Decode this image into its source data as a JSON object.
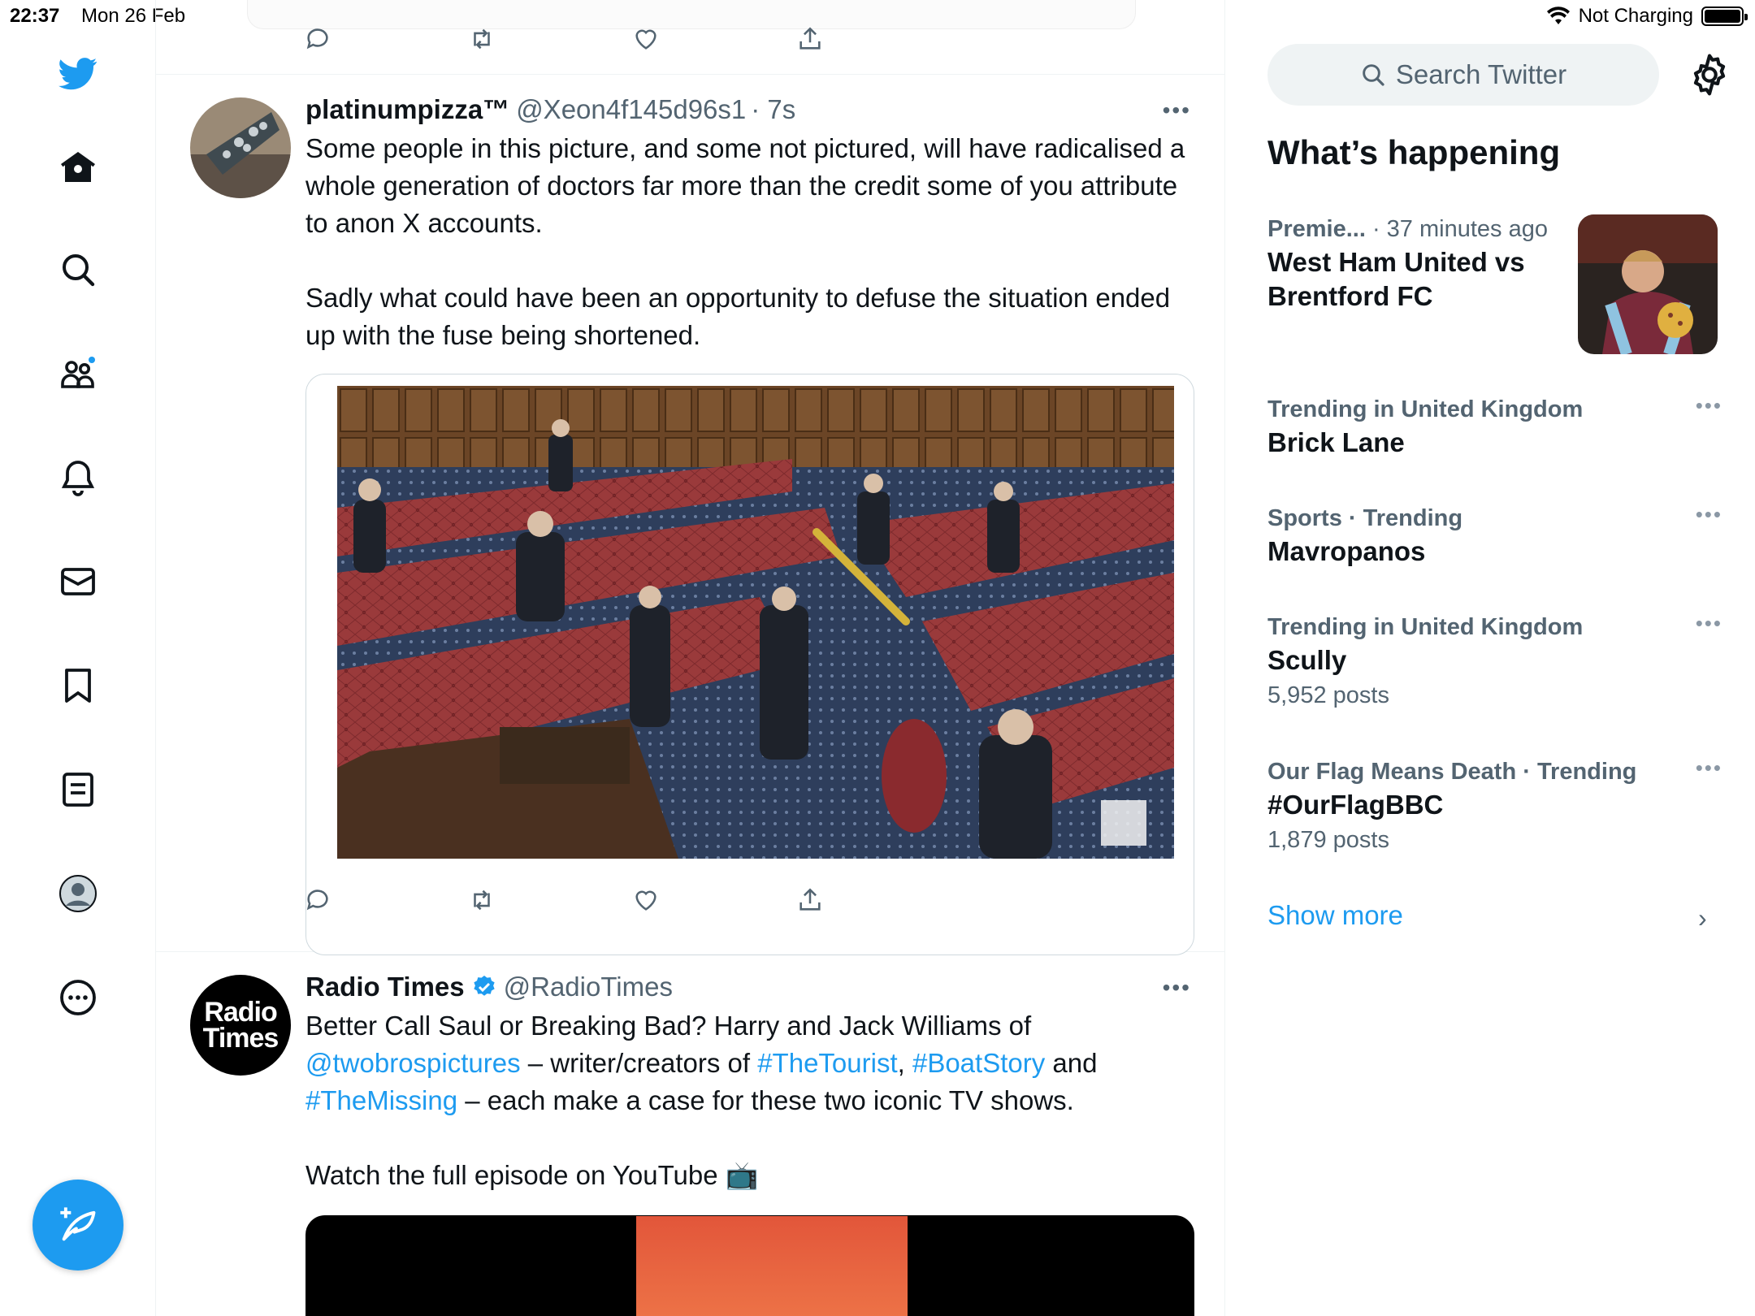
{
  "status_bar": {
    "time": "22:37",
    "date": "Mon 26 Feb",
    "network": "Not Charging"
  },
  "nav": {
    "items": [
      "home-icon",
      "search-icon",
      "communities-icon",
      "notifications-icon",
      "messages-icon",
      "bookmarks-icon",
      "lists-icon",
      "profile-icon",
      "more-icon"
    ],
    "compose_icon": "compose-tweet-icon",
    "accent": "#1d9bf0"
  },
  "timeline": {
    "tweets": [
      {
        "name": "platinumpizza™",
        "handle": "@Xeon4f145d96s1",
        "time": "· 7s",
        "text": "Some people in this picture, and some not pictured, will have radicalised a whole generation of doctors far more than the credit some of you attribute to anon X accounts.\n\nSadly what could have been an opportunity to defuse the situation ended up with the fuse being shortened."
      },
      {
        "name": "Radio Times",
        "handle": "@RadioTimes",
        "avatar_text_1": "Radio",
        "avatar_text_2": "Times",
        "text_1": "Better Call Saul or Breaking Bad? Harry and Jack Williams of",
        "mention": "@twobrospictures",
        "text_2": " – writer/creators of ",
        "tag_1": "#TheTourist",
        "text_3": ", ",
        "tag_2": "#BoatStory",
        "text_4": " and",
        "tag_3": "#TheMissing",
        "text_5": " – each make a case for these two iconic TV shows.",
        "text_6": "Watch the full episode on YouTube 📺"
      }
    ]
  },
  "sidebar_right": {
    "search_placeholder": "Search Twitter",
    "section_title": "What’s happening",
    "trends": [
      {
        "context": "Premie...",
        "context_time": "· 37 minutes ago",
        "title": "West Ham United vs Brentford FC"
      },
      {
        "context": "Trending in United Kingdom",
        "title": "Brick Lane"
      },
      {
        "context": "Sports · Trending",
        "title": "Mavropanos"
      },
      {
        "context": "Trending in United Kingdom",
        "title": "Scully",
        "count": "5,952 posts"
      },
      {
        "context": "Our Flag Means Death · Trending",
        "title": "#OurFlagBBC",
        "count": "1,879 posts"
      }
    ],
    "show_more": "Show more"
  }
}
